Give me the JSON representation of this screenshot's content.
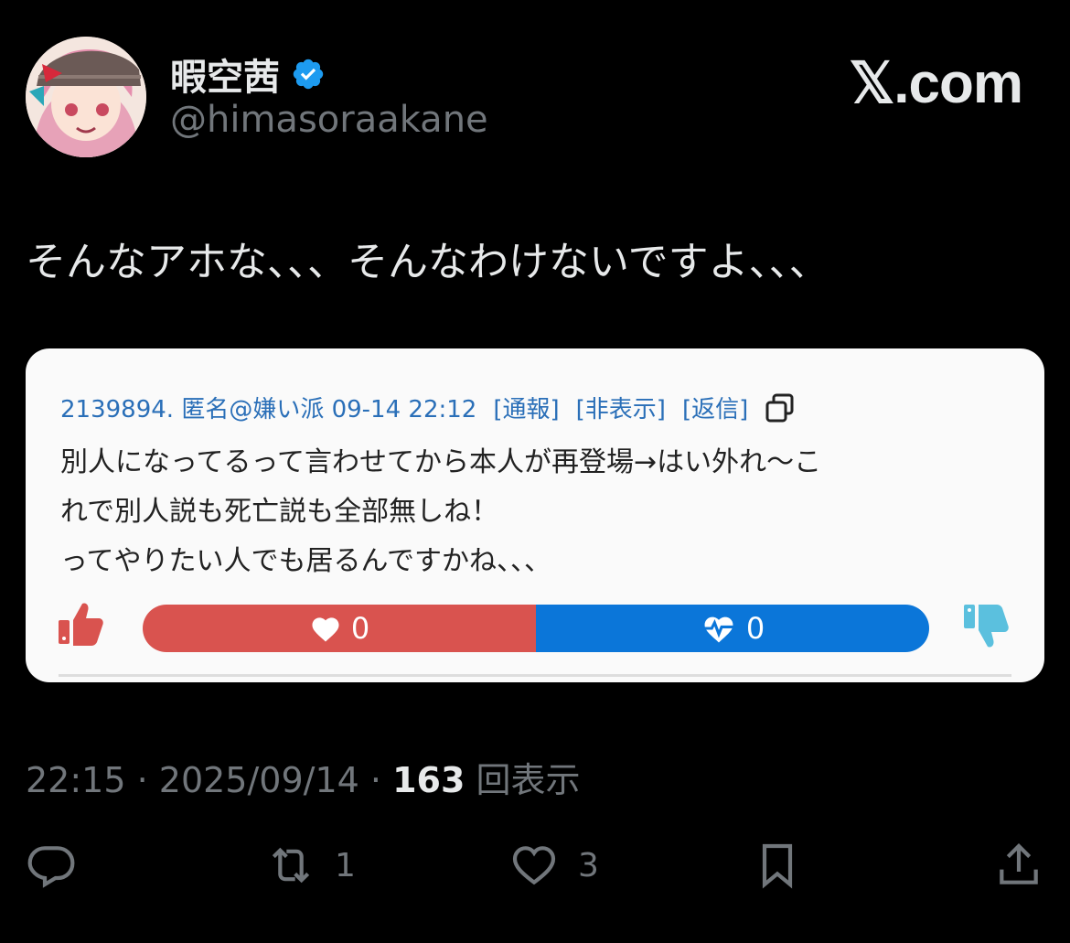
{
  "header": {
    "display_name": "暇空茜",
    "handle": "@himasoraakane",
    "site_label": "𝕏.com"
  },
  "tweet": {
    "text": "そんなアホな、、、そんなわけないですよ、、、"
  },
  "embedded_post": {
    "header_text": "2139894. 匿名@嫌い派 09-14 22:12",
    "report_label": "[通報]",
    "hide_label": "[非表示]",
    "reply_label": "[返信]",
    "body_lines": [
      "別人になってるって言わせてから本人が再登場→はい外れ〜こ",
      "れで別人説も死亡説も全部無しね！",
      "ってやりたい人でも居るんですかね、、、"
    ],
    "good_count": "0",
    "bad_count": "0"
  },
  "meta": {
    "time": "22:15",
    "date": "2025/09/14",
    "views_count": "163",
    "views_label": "回表示"
  },
  "actions": {
    "retweet_count": "1",
    "like_count": "3"
  },
  "colors": {
    "background": "#000000",
    "good_bar": "#d9534f",
    "bad_bar": "#0b76d9",
    "verified": "#1d9bf0"
  }
}
